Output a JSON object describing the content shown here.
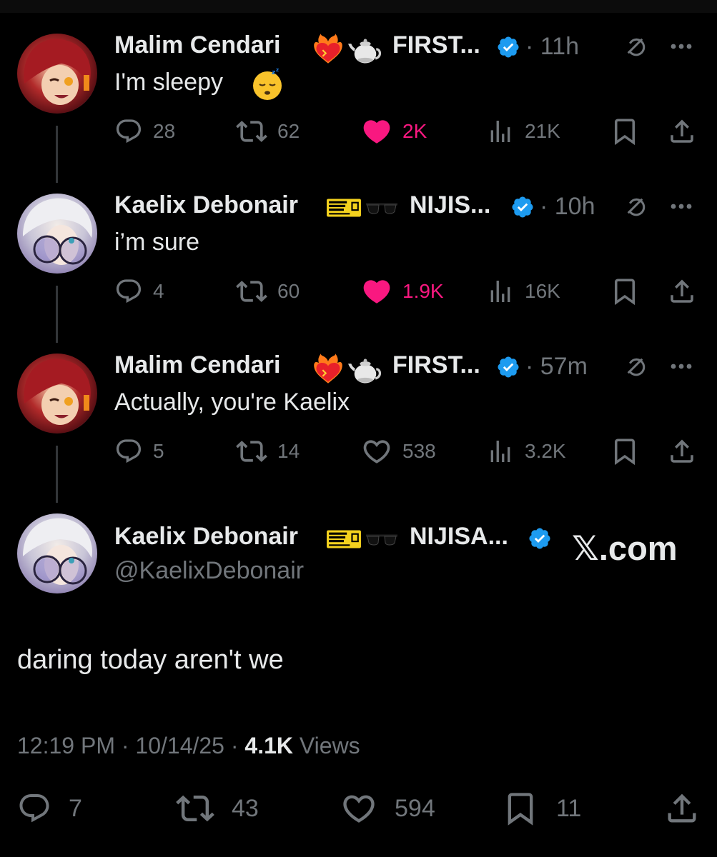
{
  "thread": [
    {
      "name": "Malim Cendari",
      "name_suffix": "FIRST...",
      "time": "· 11h",
      "text": "I'm sleepy",
      "reply_count": "28",
      "repost_count": "62",
      "like_count": "2K",
      "liked": true,
      "view_count": "21K"
    },
    {
      "name": "Kaelix Debonair",
      "name_suffix": "NIJIS...",
      "time": "· 10h",
      "text": "i’m sure",
      "reply_count": "4",
      "repost_count": "60",
      "like_count": "1.9K",
      "liked": true,
      "view_count": "16K"
    },
    {
      "name": "Malim Cendari",
      "name_suffix": "FIRST...",
      "time": "· 57m",
      "text": "Actually, you're Kaelix",
      "reply_count": "5",
      "repost_count": "14",
      "like_count": "538",
      "liked": false,
      "view_count": "3.2K"
    }
  ],
  "main_post": {
    "name": "Kaelix Debonair",
    "name_suffix": "NIJISA...",
    "handle": "@KaelixDebonair",
    "watermark": "𝕏.com",
    "text": "daring today aren't we",
    "time": "12:19 PM",
    "date": "10/14/25",
    "views_count": "4.1K",
    "views_label": "Views",
    "reply_count": "7",
    "repost_count": "43",
    "like_count": "594",
    "bookmark_count": "11"
  },
  "colors": {
    "background": "#000000",
    "text_primary": "#e7e9ea",
    "text_secondary": "#71767b",
    "like_pink": "#f91880",
    "verified_blue": "#1d9bf0"
  },
  "icons": [
    "reply-icon",
    "repost-icon",
    "like-icon",
    "views-icon",
    "bookmark-icon",
    "share-icon",
    "verified-badge-icon",
    "grok-icon",
    "more-icon",
    "ticket-emoji-icon",
    "sunglasses-emoji-icon",
    "heart-on-fire-emoji-icon",
    "teapot-emoji-icon",
    "sleeping-emoji-icon"
  ]
}
